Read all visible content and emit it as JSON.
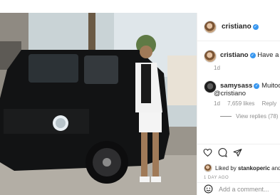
{
  "post": {
    "image_icon": "photo-car-man"
  },
  "header": {
    "username": "cristiano",
    "verified_icon": "verified-badge-icon"
  },
  "comments": [
    {
      "username": "cristiano",
      "text": "Have a goo",
      "time": "1d"
    },
    {
      "username": "samysass",
      "text": "Muitoo Sh",
      "mention": "@cristiano",
      "time": "1d",
      "likes": "7,659 likes",
      "reply": "Reply",
      "view_replies": "View replies (78)"
    }
  ],
  "likes_line": {
    "prefix": "Liked by",
    "user": "stankoperic",
    "suffix": "and"
  },
  "time_ago": "1 DAY AGO",
  "add_comment": {
    "placeholder": "Add a comment..."
  },
  "colors": {
    "verified": "#3897f0",
    "muted": "#8e8e8e",
    "text": "#262626"
  }
}
